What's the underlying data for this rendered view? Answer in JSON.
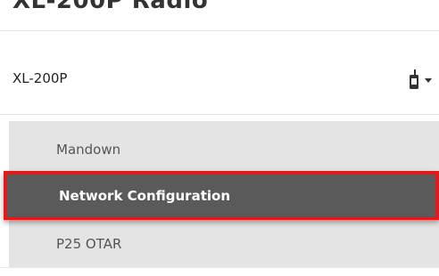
{
  "header": {
    "title_partial": "XL-200P Radio"
  },
  "device": {
    "name": "XL-200P",
    "icon": "radio-icon",
    "dropdown_icon": "caret-down-icon"
  },
  "menu": {
    "items": [
      {
        "label": "Mandown",
        "selected": false
      },
      {
        "label": "Network Configuration",
        "selected": true
      },
      {
        "label": "P25 OTAR",
        "selected": false
      }
    ]
  },
  "colors": {
    "selected_background": "#5a5a5a",
    "highlight_border": "#e11b1b",
    "menu_background": "#e4e4e4"
  }
}
